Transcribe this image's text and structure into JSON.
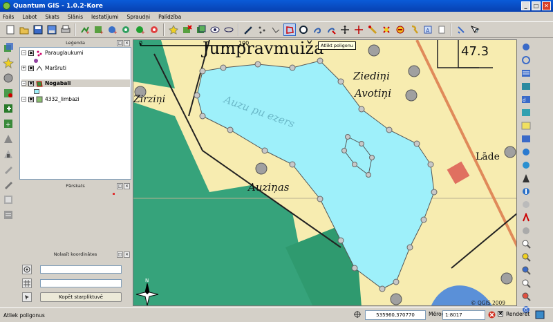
{
  "window": {
    "title": "Quantum GIS - 1.0.2-Kore",
    "min_label": "_",
    "max_label": "□",
    "close_label": "✕"
  },
  "menu": [
    "Fails",
    "Labot",
    "Skats",
    "Slānis",
    "Iestatījumi",
    "Spraudņi",
    "Palīdzība"
  ],
  "toolbar": {
    "buttons": [
      "new-project",
      "open-project",
      "save-project",
      "save-as",
      "print",
      "add-vector",
      "add-raster",
      "add-postgis",
      "add-wms",
      "add-layer",
      "new-vector",
      "remove-layer",
      "show-all",
      "hide-all",
      "toggle-editing",
      "capture-point",
      "capture-line",
      "capture-polygon",
      "move-feature",
      "split-feature",
      "delete-feature",
      "add-ring",
      "add-island",
      "pan",
      "zoom-in",
      "zoom-out",
      "zoom-full",
      "zoom-selection",
      "identify",
      "select",
      "measure",
      "help",
      "whats-this"
    ],
    "active": "capture-polygon",
    "tooltip": "Atlikt poligonu"
  },
  "legend": {
    "title": "Leģenda",
    "layers": [
      {
        "name": "Paraugl­aukumi",
        "checked": "✖"
      },
      {
        "name": "Maršruti",
        "checked": "✖"
      },
      {
        "name": "Nogabali",
        "checked": "✖"
      },
      {
        "name": "4332_limbazi",
        "checked": "✖"
      }
    ]
  },
  "overview": {
    "title": "Pārskats"
  },
  "coord_capture": {
    "title": "Nolasīt koordinātes",
    "copy_label": "Kopēt starpliktuvē"
  },
  "map": {
    "scalebar_0": "0",
    "scalebar_100": "100",
    "labels": [
      "Jumpravmuiža",
      "Ziediņi",
      "Avotiņi",
      "Auzu pu ezers",
      "Auziņas",
      "Zirziņi",
      "Lāde",
      "47.3"
    ],
    "copyright": "© QGIS 2009",
    "north": "N"
  },
  "status": {
    "message": "Atliek poligonus",
    "coords": "535960,370770",
    "scale_label": "Mērogs",
    "scale_value": "1:8017",
    "render_label": "Renderēt"
  },
  "colors": {
    "water": "#9ef0fa",
    "forest": "#36a37b",
    "land": "#f7ecb0",
    "road": "#e08a5a",
    "window_bg": "#d4d0c8"
  }
}
